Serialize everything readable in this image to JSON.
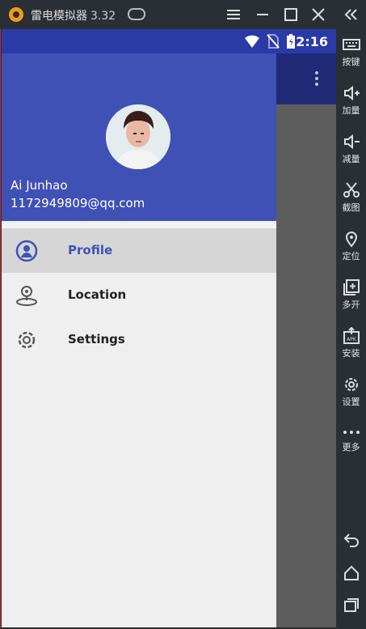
{
  "window": {
    "title": "雷电模拟器",
    "version": "3.32",
    "icons": [
      "app-logo-icon",
      "gamepad-icon",
      "menu-icon",
      "minimize-icon",
      "maximize-icon",
      "close-icon"
    ]
  },
  "android": {
    "status": {
      "time": "2:16",
      "icons": [
        "wifi-icon",
        "no-sim-icon",
        "battery-charging-icon"
      ]
    }
  },
  "drawer": {
    "header": {
      "name": "Ai Junhao",
      "email": "1172949809@qq.com"
    },
    "items": [
      {
        "label": "Profile",
        "icon": "profile-icon",
        "selected": true
      },
      {
        "label": "Location",
        "icon": "location-icon",
        "selected": false
      },
      {
        "label": "Settings",
        "icon": "settings-icon",
        "selected": false
      }
    ]
  },
  "sidebar": {
    "items": [
      {
        "label": "按键",
        "icon": "keyboard-icon"
      },
      {
        "label": "加量",
        "icon": "volume-up-icon"
      },
      {
        "label": "减量",
        "icon": "volume-down-icon"
      },
      {
        "label": "截图",
        "icon": "scissors-icon"
      },
      {
        "label": "定位",
        "icon": "location-pin-icon"
      },
      {
        "label": "多开",
        "icon": "multi-open-icon"
      },
      {
        "label": "安装",
        "icon": "apk-install-icon"
      },
      {
        "label": "设置",
        "icon": "gear-icon"
      },
      {
        "label": "更多",
        "icon": "more-icon"
      }
    ],
    "nav": [
      "back-icon",
      "home-icon",
      "recents-icon"
    ]
  },
  "colors": {
    "primary": "#3f51b5",
    "status_bar": "#2b3aa6",
    "emulator_chrome": "#2a2f36",
    "drawer_bg": "#efefef"
  }
}
